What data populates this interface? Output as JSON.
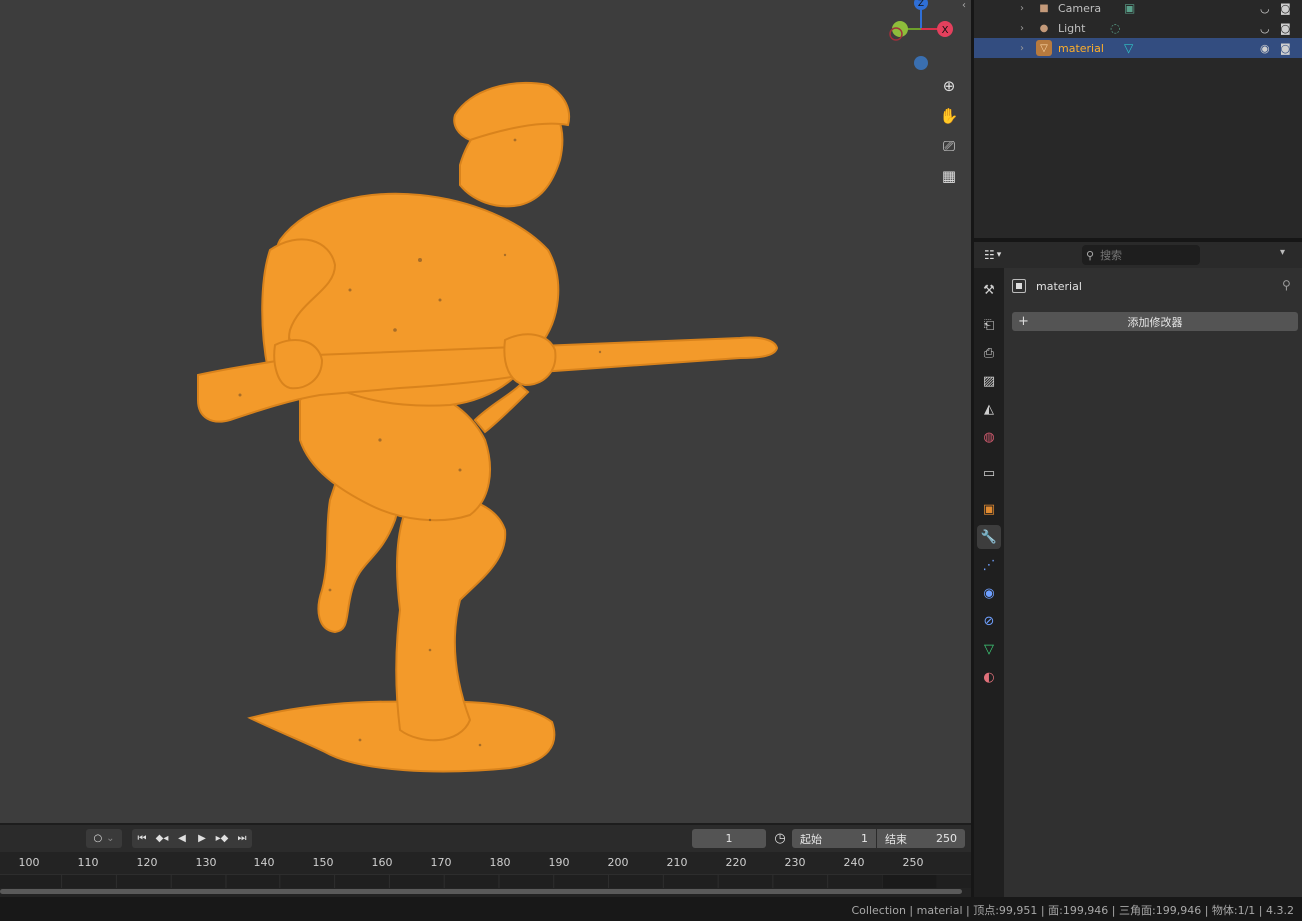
{
  "outliner": {
    "rows": [
      {
        "label": "Camera",
        "icon": "camera-object-icon"
      },
      {
        "label": "Light",
        "icon": "light-object-icon"
      },
      {
        "label": "material",
        "icon": "mesh-object-icon",
        "selected": true
      }
    ]
  },
  "properties": {
    "search_placeholder": "搜索",
    "object_name": "material",
    "add_modifier_label": "添加修改器",
    "active_tab": "modifier",
    "tabs": [
      "tool",
      "render",
      "output",
      "view-layer",
      "scene",
      "world",
      "collection",
      "object",
      "modifier",
      "particles",
      "physics",
      "constraints",
      "data",
      "material"
    ]
  },
  "timeline": {
    "current_frame": "1",
    "start_label": "起始",
    "start_frame": "1",
    "end_label": "结束",
    "end_frame": "250",
    "ticks": [
      "100",
      "110",
      "120",
      "130",
      "140",
      "150",
      "160",
      "170",
      "180",
      "190",
      "200",
      "210",
      "220",
      "230",
      "240",
      "250"
    ]
  },
  "gizmo": {
    "x_label": "X",
    "z_label": "Z"
  },
  "statusbar": {
    "text": "Collection | material | 顶点:99,951 | 面:199,946 | 三角面:199,946 | 物体:1/1 | 4.3.2"
  },
  "colors": {
    "viewport_bg": "#3d3d3d",
    "model": "#f39a2a",
    "selection_highlight": "#334d80",
    "selected_text": "#ffaf29"
  }
}
